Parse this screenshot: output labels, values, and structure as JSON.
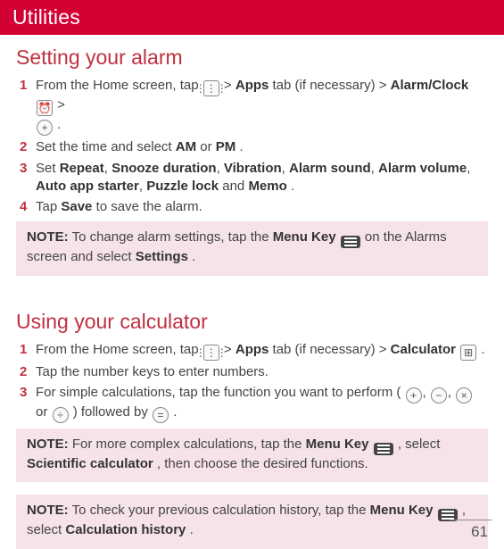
{
  "header": {
    "title": "Utilities"
  },
  "alarm": {
    "heading": "Setting your alarm",
    "steps": {
      "s1_a": "From the Home screen, tap ",
      "s1_b": " > ",
      "s1_apps": "Apps",
      "s1_c": " tab (if necessary) > ",
      "s1_alarmclock": "Alarm/Clock",
      "s1_d": " > ",
      "s1_e": ".",
      "s2_a": "Set the time and select ",
      "s2_am": "AM",
      "s2_or": " or ",
      "s2_pm": "PM",
      "s2_end": ".",
      "s3_a": "Set ",
      "s3_repeat": "Repeat",
      "s3_c": ", ",
      "s3_snooze": "Snooze duration",
      "s3_vib": "Vibration",
      "s3_sound": "Alarm sound",
      "s3_vol": "Alarm volume",
      "s3_auto": "Auto app starter",
      "s3_puzzle": "Puzzle lock",
      "s3_and": " and ",
      "s3_memo": "Memo",
      "s3_end": ".",
      "s4_a": "Tap ",
      "s4_save": "Save",
      "s4_b": " to save the alarm."
    },
    "note": {
      "lead": "NOTE:",
      "a": " To change alarm settings, tap the ",
      "menu": "Menu Key",
      "b": " on the Alarms screen and select ",
      "settings": "Settings",
      "end": "."
    }
  },
  "calc": {
    "heading": "Using your calculator",
    "steps": {
      "s1_a": "From the Home screen, tap ",
      "s1_b": " > ",
      "s1_apps": "Apps",
      "s1_c": " tab (if necessary) > ",
      "s1_calc": "Calculator",
      "s1_d": ".",
      "s2": "Tap the number keys to enter numbers.",
      "s3_a": "For simple calculations, tap the function you want to perform (",
      "s3_c": ", ",
      "s3_or": " or ",
      "s3_close": ") followed by ",
      "s3_end": "."
    },
    "note1": {
      "lead": "NOTE:",
      "a": " For more complex calculations, tap the ",
      "menu": "Menu Key",
      "b": ", select ",
      "sci": "Scientific calculator",
      "c": ", then choose the desired functions."
    },
    "note2": {
      "lead": "NOTE:",
      "a": " To check your previous calculation history, tap the ",
      "menu": "Menu Key",
      "b": ", select ",
      "hist": "Calculation history",
      "end": "."
    }
  },
  "page": "61"
}
